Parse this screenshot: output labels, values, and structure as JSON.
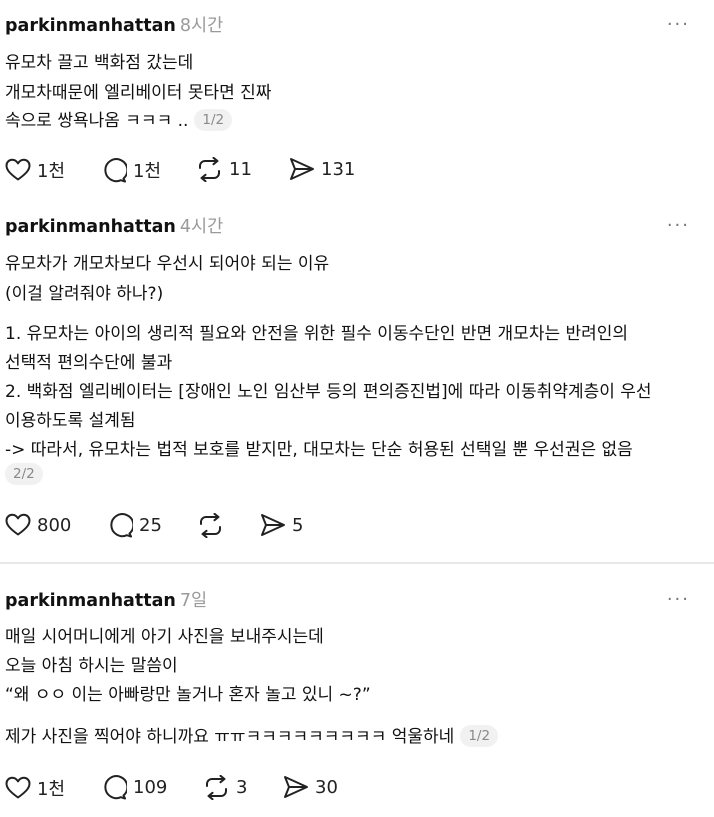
{
  "posts": [
    {
      "username": "parkinmanhattan",
      "time": "8시간",
      "lines": [
        "유모차 끌고 백화점 갔는데",
        "개모차때문에 엘리베이터 못타면 진짜",
        "속으로 쌍욕나옴 ㅋㅋㅋ .."
      ],
      "pager": "1/2",
      "actions": {
        "likes": "1천",
        "comments": "1천",
        "reposts": "11",
        "shares": "131"
      }
    },
    {
      "username": "parkinmanhattan",
      "time": "4시간",
      "lines": [
        "유모차가 개모차보다 우선시 되어야 되는 이유",
        "(이걸 알려줘야 하나?)",
        "1. 유모차는 아이의 생리적 필요와 안전을 위한 필수 이동수단인 반면 개모차는 반려인의",
        "선택적 편의수단에 불과",
        "2. 백화점 엘리베이터는 [장애인 노인 임산부 등의 편의증진법]에 따라 이동취약계층이 우선",
        "이용하도록 설계됨",
        "-> 따라서, 유모차는 법적 보호를 받지만, 대모차는 단순 허용된 선택일 뿐 우선권은 없음"
      ],
      "pager": "2/2",
      "actions": {
        "likes": "800",
        "comments": "25",
        "reposts": "",
        "shares": "5"
      }
    },
    {
      "username": "parkinmanhattan",
      "time": "7일",
      "lines": [
        "매일 시어머니에게 아기 사진을 보내주시는데",
        "오늘 아침 하시는 말씀이",
        "“왜 ㅇㅇ 이는 아빠랑만 놀거나 혼자 놀고 있니 ~?”",
        "제가 사진을 찍어야 하니까요 ㅠㅠㅋㅋㅋㅋㅋㅋㅋㅋㅋ 억울하네"
      ],
      "pager": "1/2",
      "actions": {
        "likes": "1천",
        "comments": "109",
        "reposts": "3",
        "shares": "30"
      }
    }
  ],
  "icons": {
    "more": "more-horizontal-icon",
    "like": "heart-icon",
    "comment": "comment-bubble-icon",
    "repost": "repost-icon",
    "share": "send-icon"
  },
  "more_glyph": "···"
}
